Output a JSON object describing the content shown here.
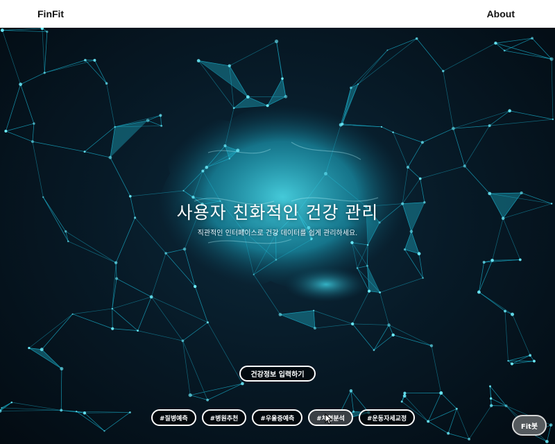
{
  "header": {
    "brand": "FinFit",
    "about": "About"
  },
  "hero": {
    "title": "사용자 친화적인 건강 관리",
    "subtitle": "직관적인 인터페이스로 건강 데이터를 쉽게 관리하세요.",
    "cta_label": "건강정보 입력하기"
  },
  "tags": [
    {
      "label": "#질병예측"
    },
    {
      "label": "#병원추천"
    },
    {
      "label": "#우울증예측"
    },
    {
      "label": "#체형분석"
    },
    {
      "label": "#운동자세교정"
    }
  ],
  "chatbot": {
    "label": "Fit봇"
  },
  "colors": {
    "accent": "#29d3e6",
    "background": "#06141f"
  }
}
